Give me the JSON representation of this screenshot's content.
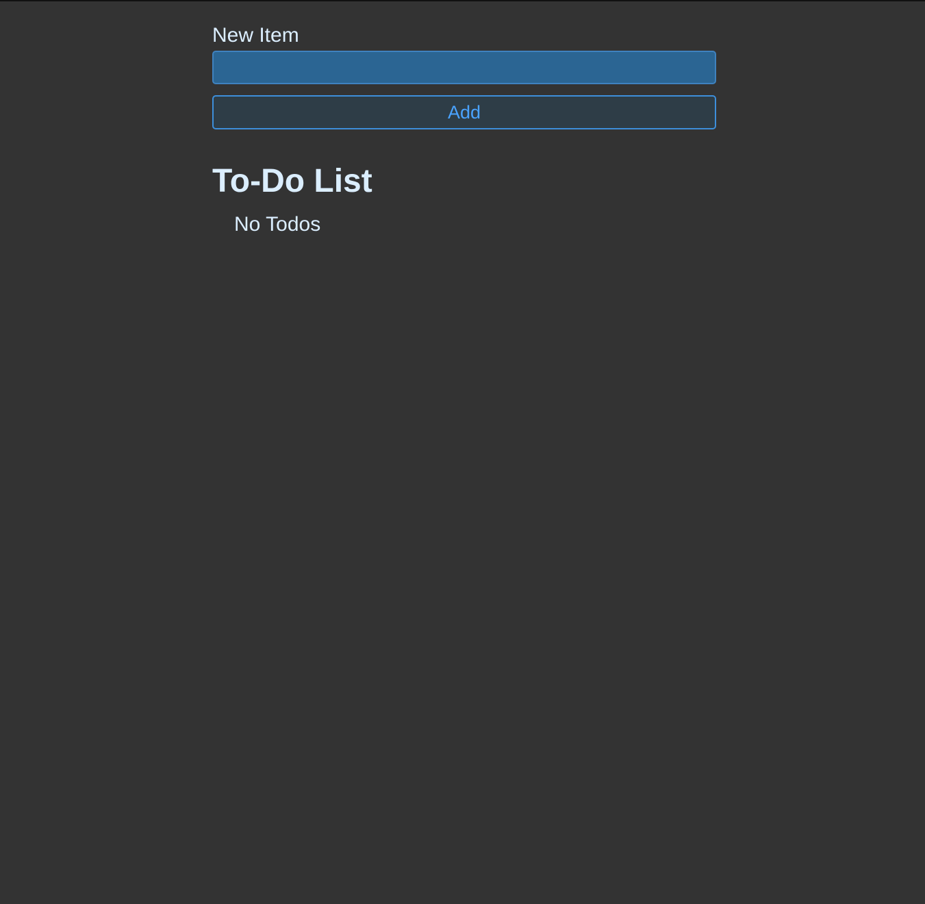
{
  "form": {
    "label": "New Item",
    "input_value": "",
    "input_placeholder": "",
    "add_label": "Add"
  },
  "list": {
    "title": "To-Do List",
    "empty_message": "No Todos",
    "items": []
  },
  "colors": {
    "background": "#333333",
    "text": "#dbeeff",
    "input_background": "#2b6593",
    "input_border": "#3f82bf",
    "button_background": "#2e3d47",
    "button_border": "#3d8fdb",
    "button_text": "#4aa3ff"
  }
}
